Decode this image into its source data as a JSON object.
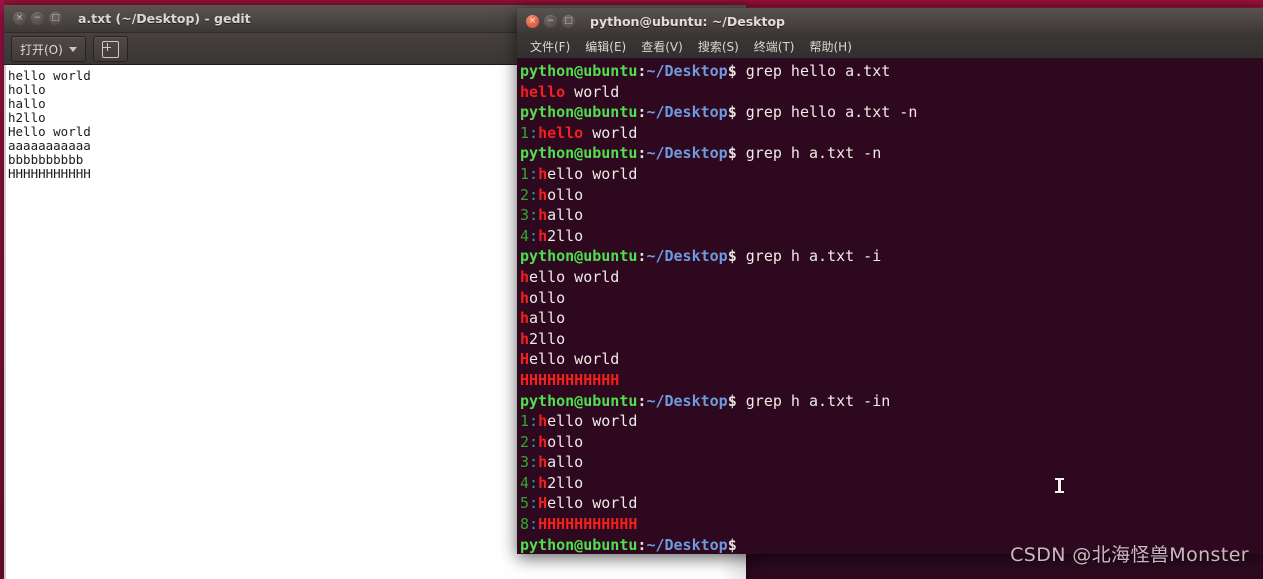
{
  "desktop": {
    "watermark": "CSDN @北海怪兽Monster",
    "background_color": "#2d0a20"
  },
  "gedit": {
    "title": "a.txt (~/Desktop) - gedit",
    "window_buttons": [
      {
        "name": "close",
        "glyph": "×"
      },
      {
        "name": "minimize",
        "glyph": "−"
      },
      {
        "name": "maximize",
        "glyph": "□"
      }
    ],
    "toolbar": {
      "open_label": "打开(O)",
      "new_document_tooltip": "新建文档"
    },
    "document_lines": [
      "hello world",
      "hollo",
      "hallo",
      "h2llo",
      "Hello world",
      "aaaaaaaaaaa",
      "bbbbbbbbbb",
      "HHHHHHHHHHH"
    ]
  },
  "terminal": {
    "title": "python@ubuntu: ~/Desktop",
    "window_buttons": [
      {
        "name": "close",
        "glyph": "×"
      },
      {
        "name": "minimize",
        "glyph": "−"
      },
      {
        "name": "maximize",
        "glyph": "□"
      }
    ],
    "menus": [
      "文件(F)",
      "编辑(E)",
      "查看(V)",
      "搜索(S)",
      "终端(T)",
      "帮助(H)"
    ],
    "prompt": {
      "user_host": "python@ubuntu",
      "colon": ":",
      "path": "~/Desktop",
      "dollar": "$"
    },
    "colors": {
      "background": "#2d081e",
      "user_host": "#4ee04e",
      "path": "#6f9ade",
      "text": "#f0ebe6",
      "match": "#f32020",
      "line_number": "#2faa2f",
      "separator": "#14a9a9"
    },
    "session": [
      {
        "type": "prompt",
        "command": " grep hello a.txt"
      },
      {
        "type": "out",
        "lnum": "",
        "match": "hello",
        "rest": " world"
      },
      {
        "type": "prompt",
        "command": " grep hello a.txt -n"
      },
      {
        "type": "out",
        "lnum": "1",
        "match": "hello",
        "rest": " world"
      },
      {
        "type": "prompt",
        "command": " grep h a.txt -n"
      },
      {
        "type": "out",
        "lnum": "1",
        "match": "h",
        "rest": "ello world"
      },
      {
        "type": "out",
        "lnum": "2",
        "match": "h",
        "rest": "ollo"
      },
      {
        "type": "out",
        "lnum": "3",
        "match": "h",
        "rest": "allo"
      },
      {
        "type": "out",
        "lnum": "4",
        "match": "h",
        "rest": "2llo"
      },
      {
        "type": "prompt",
        "command": " grep h a.txt -i"
      },
      {
        "type": "out",
        "lnum": "",
        "match": "h",
        "rest": "ello world"
      },
      {
        "type": "out",
        "lnum": "",
        "match": "h",
        "rest": "ollo"
      },
      {
        "type": "out",
        "lnum": "",
        "match": "h",
        "rest": "allo"
      },
      {
        "type": "out",
        "lnum": "",
        "match": "h",
        "rest": "2llo"
      },
      {
        "type": "out",
        "lnum": "",
        "match": "H",
        "rest": "ello world"
      },
      {
        "type": "out",
        "lnum": "",
        "match": "HHHHHHHHHHH",
        "rest": ""
      },
      {
        "type": "prompt",
        "command": " grep h a.txt -in"
      },
      {
        "type": "out",
        "lnum": "1",
        "match": "h",
        "rest": "ello world"
      },
      {
        "type": "out",
        "lnum": "2",
        "match": "h",
        "rest": "ollo"
      },
      {
        "type": "out",
        "lnum": "3",
        "match": "h",
        "rest": "allo"
      },
      {
        "type": "out",
        "lnum": "4",
        "match": "h",
        "rest": "2llo"
      },
      {
        "type": "out",
        "lnum": "5",
        "match": "H",
        "rest": "ello world"
      },
      {
        "type": "out",
        "lnum": "8",
        "match": "HHHHHHHHHHH",
        "rest": ""
      },
      {
        "type": "prompt",
        "command": ""
      }
    ]
  }
}
